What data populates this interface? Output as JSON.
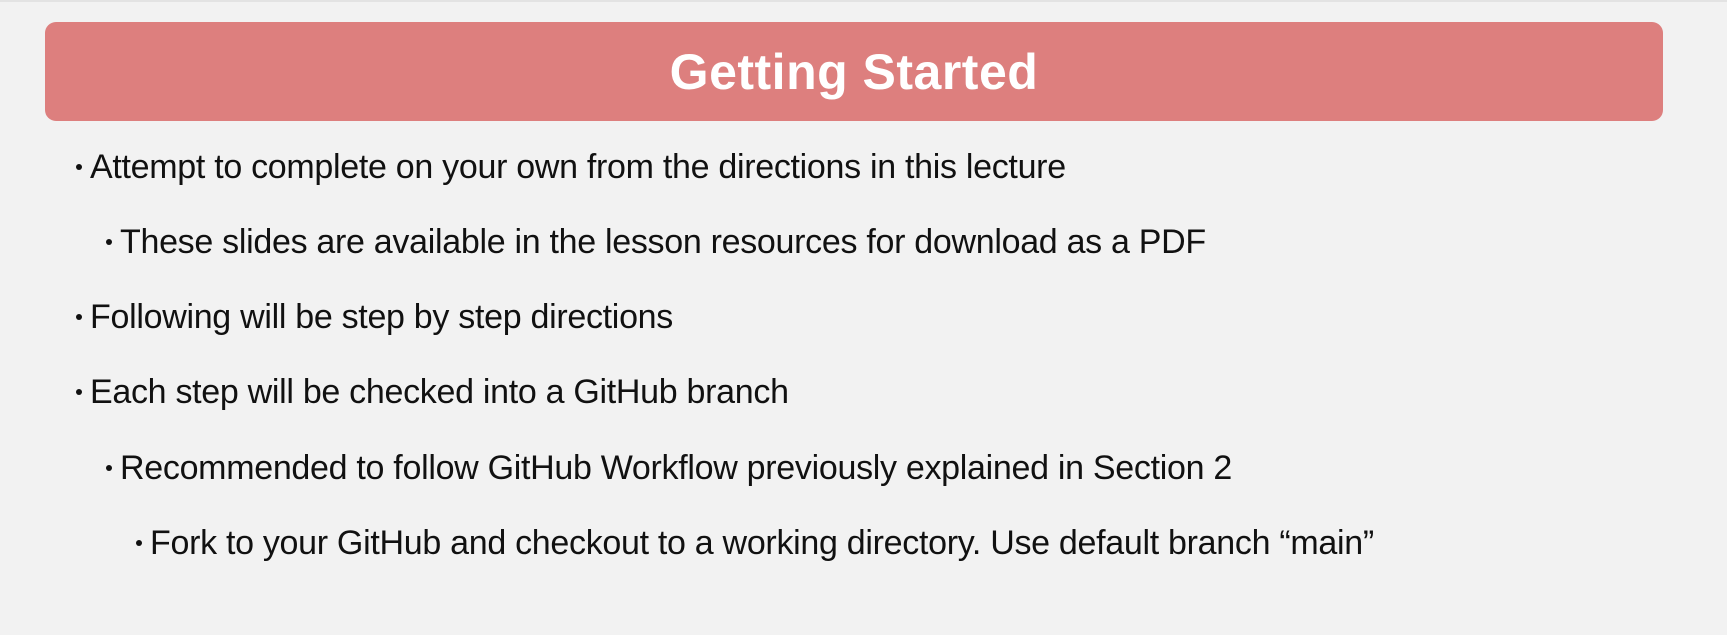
{
  "slide": {
    "title": "Getting Started",
    "bullets": [
      {
        "level": 1,
        "text": "Attempt to complete on your own from the directions in this lecture"
      },
      {
        "level": 2,
        "text": "These slides are available in the lesson resources for download as a PDF"
      },
      {
        "level": 1,
        "text": "Following will be step by step directions"
      },
      {
        "level": 1,
        "text": "Each step will be checked into a GitHub branch"
      },
      {
        "level": 2,
        "text": "Recommended to follow GitHub Workflow previously explained in Section 2"
      },
      {
        "level": 3,
        "text": "Fork to your GitHub and checkout to a working directory. Use default branch “main”"
      }
    ]
  },
  "colors": {
    "banner": "#dd7f7e",
    "background": "#f2f2f2",
    "title_text": "#ffffff",
    "body_text": "#111111"
  }
}
